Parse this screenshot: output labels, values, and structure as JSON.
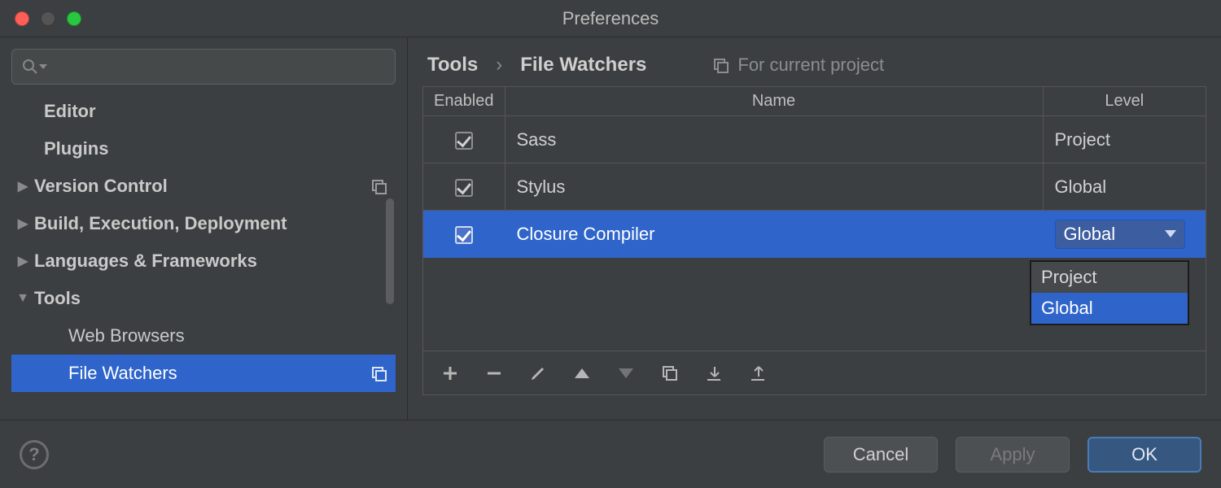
{
  "window": {
    "title": "Preferences"
  },
  "search": {
    "placeholder": ""
  },
  "sidebar": {
    "items": [
      {
        "label": "Editor"
      },
      {
        "label": "Plugins"
      },
      {
        "label": "Version Control"
      },
      {
        "label": "Build, Execution, Deployment"
      },
      {
        "label": "Languages & Frameworks"
      },
      {
        "label": "Tools"
      },
      {
        "label": "Web Browsers"
      },
      {
        "label": "File Watchers"
      }
    ]
  },
  "breadcrumb": {
    "root": "Tools",
    "leaf": "File Watchers",
    "scope": "For current project"
  },
  "table": {
    "headers": {
      "enabled": "Enabled",
      "name": "Name",
      "level": "Level"
    },
    "rows": [
      {
        "enabled": true,
        "name": "Sass",
        "level": "Project"
      },
      {
        "enabled": true,
        "name": "Stylus",
        "level": "Global"
      },
      {
        "enabled": true,
        "name": "Closure Compiler",
        "level": "Global"
      }
    ]
  },
  "level_dropdown": {
    "options": [
      "Project",
      "Global"
    ],
    "selected": "Global"
  },
  "buttons": {
    "cancel": "Cancel",
    "apply": "Apply",
    "ok": "OK"
  }
}
